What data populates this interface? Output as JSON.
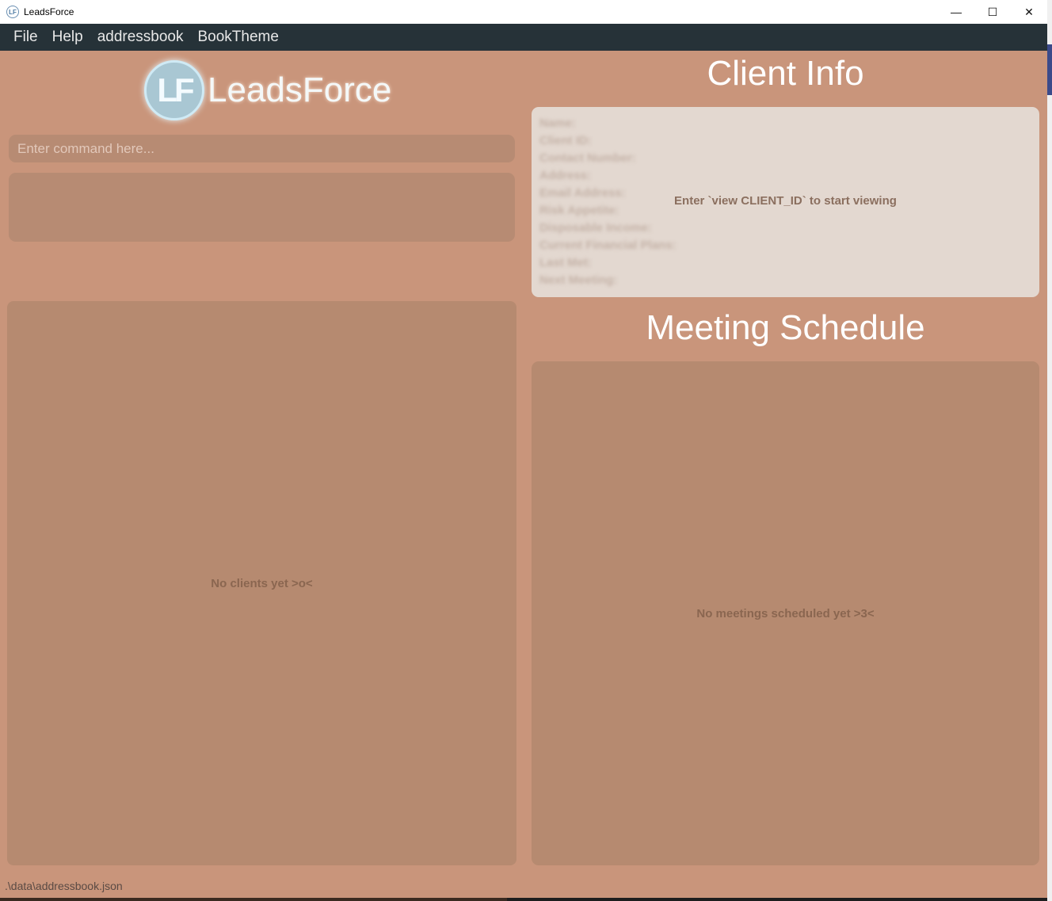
{
  "window": {
    "title": "LeadsForce",
    "icon_label": "LF",
    "controls": {
      "minimize": "—",
      "maximize": "☐",
      "close": "✕"
    }
  },
  "menu": {
    "items": [
      "File",
      "Help",
      "addressbook",
      "BookTheme"
    ]
  },
  "logo": {
    "mark": "LF",
    "text": "LeadsForce"
  },
  "command": {
    "placeholder": "Enter command here..."
  },
  "client_list": {
    "empty_text": "No clients yet >o<"
  },
  "client_info": {
    "title": "Client Info",
    "fields": [
      "Name:",
      "Client ID:",
      "Contact Number:",
      "Address:",
      "Email Address:",
      "Risk Appetite:",
      "Disposable Income:",
      "Current Financial Plans:",
      "Last Met:",
      "Next Meeting:"
    ],
    "hint": "Enter `view CLIENT_ID` to start viewing"
  },
  "meeting_schedule": {
    "title": "Meeting Schedule",
    "empty_text": "No meetings scheduled yet >3<"
  },
  "status": {
    "file_path": ".\\data\\addressbook.json"
  },
  "colors": {
    "background": "#c9957b",
    "menubar": "#263238",
    "panel": "#b68a70",
    "card": "#e3d8d0"
  }
}
